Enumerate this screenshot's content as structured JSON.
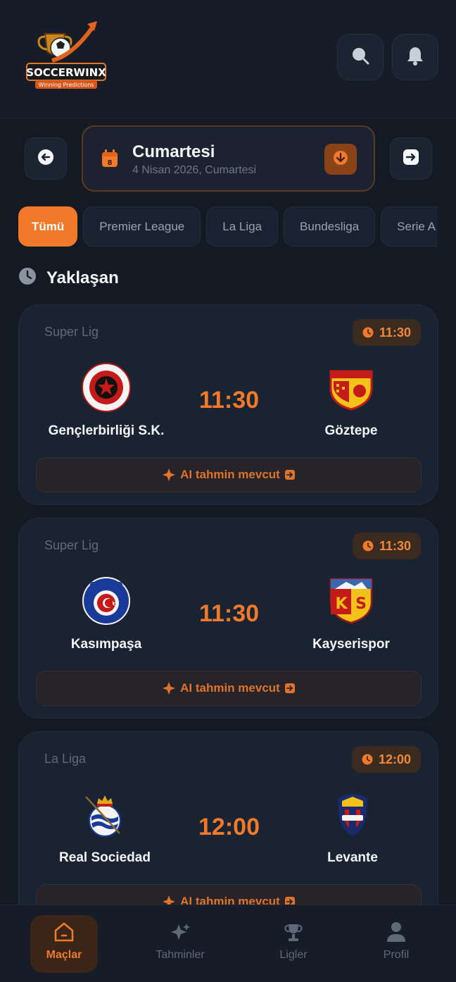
{
  "header": {
    "logo_text": "SOCCERWINX",
    "logo_tagline": "Winning Predictions"
  },
  "date": {
    "title": "Cumartesi",
    "subtitle": "4 Nisan 2026, Cumartesi",
    "calendar_day": "8"
  },
  "filters": [
    "Tümü",
    "Premier League",
    "La Liga",
    "Bundesliga",
    "Serie A"
  ],
  "section": {
    "title": "Yaklaşan"
  },
  "matches": [
    {
      "league": "Super Lig",
      "time": "11:30",
      "home": "Gençlerbirliği S.K.",
      "away": "Göztepe",
      "ai_label": "AI tahmin mevcut"
    },
    {
      "league": "Super Lig",
      "time": "11:30",
      "home": "Kasımpaşa",
      "away": "Kayserispor",
      "ai_label": "AI tahmin mevcut"
    },
    {
      "league": "La Liga",
      "time": "12:00",
      "home": "Real Sociedad",
      "away": "Levante",
      "ai_label": "AI tahmin mevcut"
    }
  ],
  "tabs": [
    "Maçlar",
    "Tahminler",
    "Ligler",
    "Profil"
  ],
  "colors": {
    "accent": "#f07a2a",
    "background": "#141a24",
    "card": "#1a2332"
  }
}
